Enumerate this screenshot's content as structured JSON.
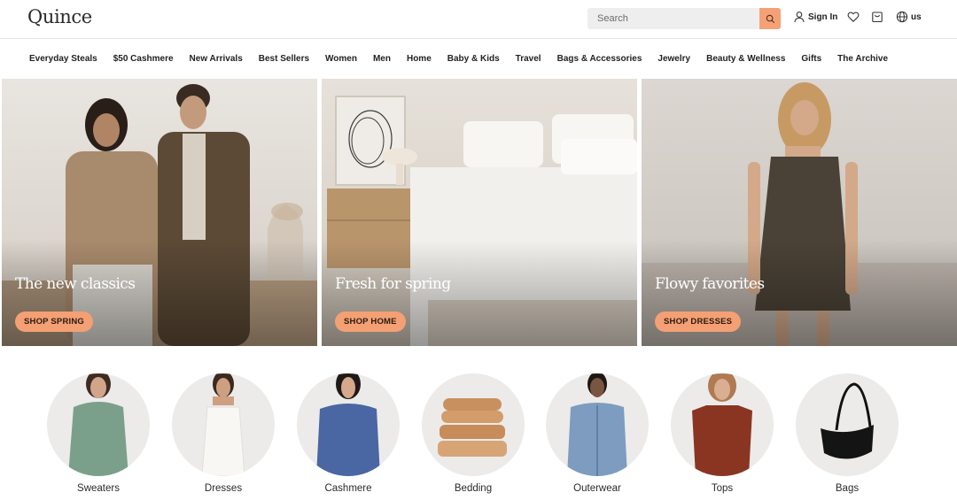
{
  "header": {
    "logo": "Quince",
    "search_placeholder": "Search",
    "sign_in": "Sign In",
    "locale": "us"
  },
  "nav": {
    "items": [
      "Everyday Steals",
      "$50 Cashmere",
      "New Arrivals",
      "Best Sellers",
      "Women",
      "Men",
      "Home",
      "Baby & Kids",
      "Travel",
      "Bags & Accessories",
      "Jewelry",
      "Beauty & Wellness",
      "Gifts",
      "The Archive"
    ]
  },
  "heroes": [
    {
      "title": "The new classics",
      "button": "SHOP SPRING"
    },
    {
      "title": "Fresh for spring",
      "button": "SHOP HOME"
    },
    {
      "title": "Flowy favorites",
      "button": "SHOP DRESSES"
    }
  ],
  "categories": [
    {
      "label": "Sweaters",
      "icon": "sweater-model-image"
    },
    {
      "label": "Dresses",
      "icon": "dress-model-image"
    },
    {
      "label": "Cashmere",
      "icon": "cashmere-model-image"
    },
    {
      "label": "Bedding",
      "icon": "folded-bedding-image"
    },
    {
      "label": "Outerwear",
      "icon": "denim-jacket-model-image"
    },
    {
      "label": "Tops",
      "icon": "tshirt-model-image"
    },
    {
      "label": "Bags",
      "icon": "black-shoulder-bag-image"
    }
  ],
  "colors": {
    "accent": "#f4a074",
    "text": "#222222",
    "search_bg": "#eeeeee"
  },
  "icons": {
    "search": "search-icon",
    "user": "user-icon",
    "heart": "heart-icon",
    "cart": "cart-icon",
    "globe": "globe-icon"
  }
}
